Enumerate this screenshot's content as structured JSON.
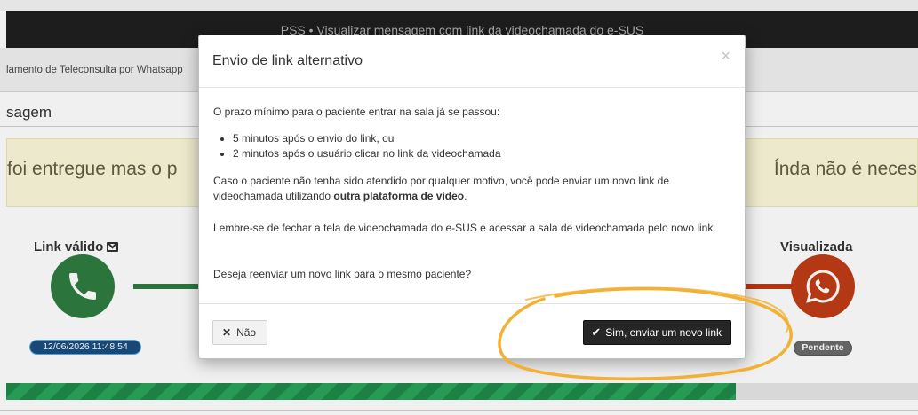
{
  "app": {
    "title": "PSS • Visualizar mensagem com link da videochamada do e-SUS",
    "breadcrumb": "lamento de Teleconsulta por Whatsapp",
    "section_title": "sagem",
    "alert_left": "foi entregue mas o p",
    "alert_right": "Índa não é neces",
    "step_left_label": "Link válido",
    "step_right_label": "Visualizada",
    "date_badge": "12/06/2026 11:48:54",
    "pending_badge": "Pendente",
    "progress_fraction": 0.8
  },
  "modal": {
    "title": "Envio de link alternativo",
    "close_label": "×",
    "intro": "O prazo mínimo para o paciente entrar na sala já se passou:",
    "bullets": [
      "5 minutos após o envio do link, ou",
      "2 minutos após o usuário clicar no link da videochamada"
    ],
    "p2_before": "Caso o paciente não tenha sido atendido por qualquer motivo, você pode enviar um novo link de videochamada utilizando ",
    "p2_bold": "outra plataforma de vídeo",
    "p2_after": ".",
    "p3": "Lembre-se de fechar a tela de videochamada do e-SUS e acessar a sala de videochamada pelo novo link.",
    "question": "Deseja reenviar um novo link para o mesmo paciente?",
    "no_button": "Não",
    "yes_button": "Sim, enviar um novo link"
  },
  "icons": {
    "phone": "phone-icon",
    "whatsapp": "whatsapp-icon",
    "mail": "mail-icon",
    "times": "times-icon",
    "check": "check-icon"
  },
  "colors": {
    "success": "#2e7d40",
    "danger": "#c13c16",
    "highlight": "#f2b134",
    "primary_button": "#262626"
  }
}
